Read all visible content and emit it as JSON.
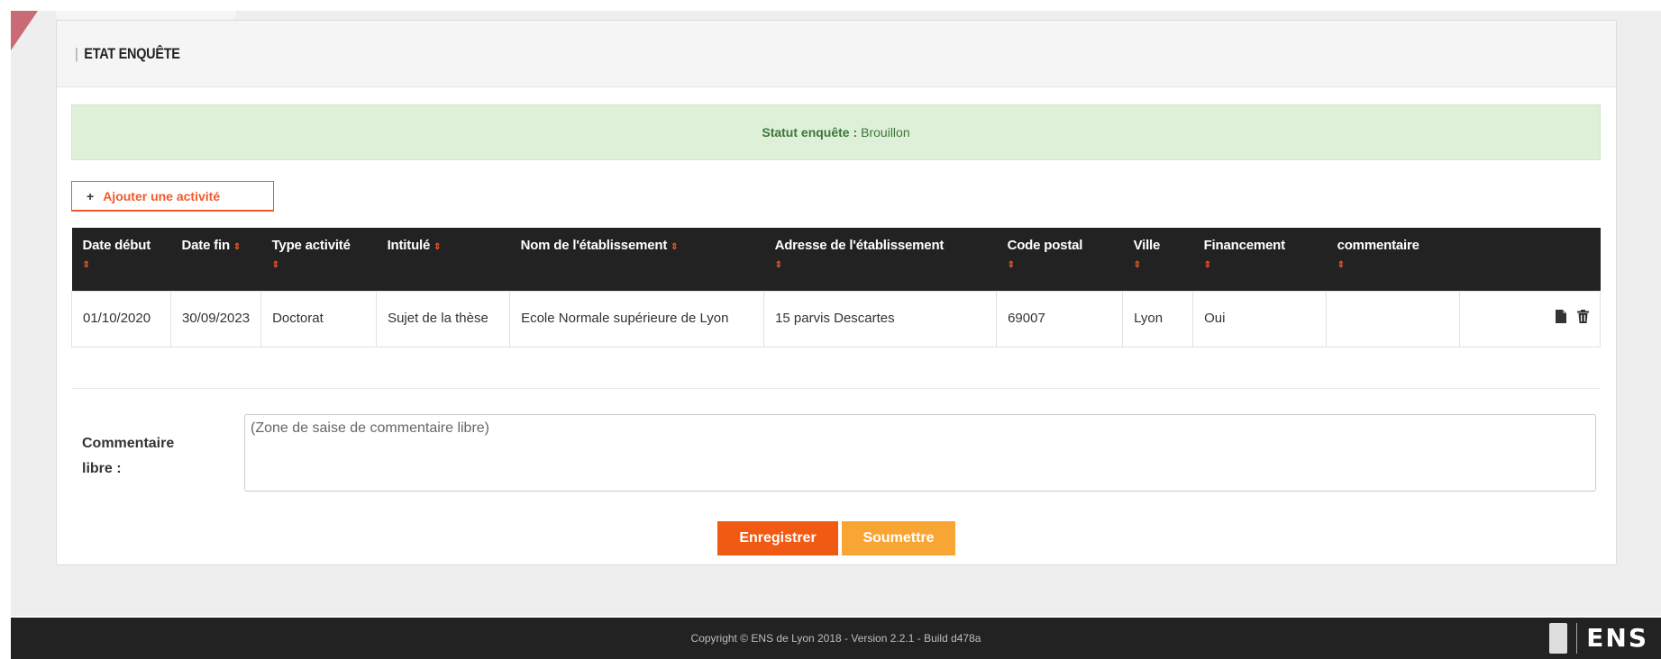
{
  "panel": {
    "title": "ETAT ENQUÊTE"
  },
  "status": {
    "label": "Statut enquête :",
    "value": "Brouillon"
  },
  "add_button": {
    "icon": "+",
    "label": "Ajouter une activité"
  },
  "table": {
    "sort_icon": "⇕",
    "headers": {
      "date_debut": "Date début",
      "date_fin": "Date fin",
      "type_activite": "Type activité",
      "intitule": "Intitulé",
      "nom_etablissement": "Nom de l'établissement",
      "adresse": "Adresse de l'établissement",
      "code_postal": "Code postal",
      "ville": "Ville",
      "financement": "Financement",
      "commentaire": "commentaire"
    },
    "rows": [
      {
        "date_debut": "01/10/2020",
        "date_fin": "30/09/2023",
        "type_activite": "Doctorat",
        "intitule": "Sujet de la thèse",
        "nom_etablissement": "Ecole Normale supérieure de Lyon",
        "adresse": "15 parvis Descartes",
        "code_postal": "69007",
        "ville": "Lyon",
        "financement": "Oui",
        "commentaire": ""
      }
    ],
    "action_icons": [
      "file-icon",
      "trash-icon"
    ]
  },
  "comment": {
    "label": "Commentaire libre :",
    "placeholder": "(Zone de saise de commentaire libre)"
  },
  "buttons": {
    "save": "Enregistrer",
    "submit": "Soumettre"
  },
  "footer": {
    "copyright": "Copyright © ENS de Lyon 2018 - Version 2.2.1 - Build d478a",
    "logo_text": "ENS"
  },
  "colors": {
    "accent": "#f05a28",
    "save": "#f05a12",
    "submit": "#f9a533",
    "status_bg": "#dff0d8",
    "table_header": "#222222"
  }
}
